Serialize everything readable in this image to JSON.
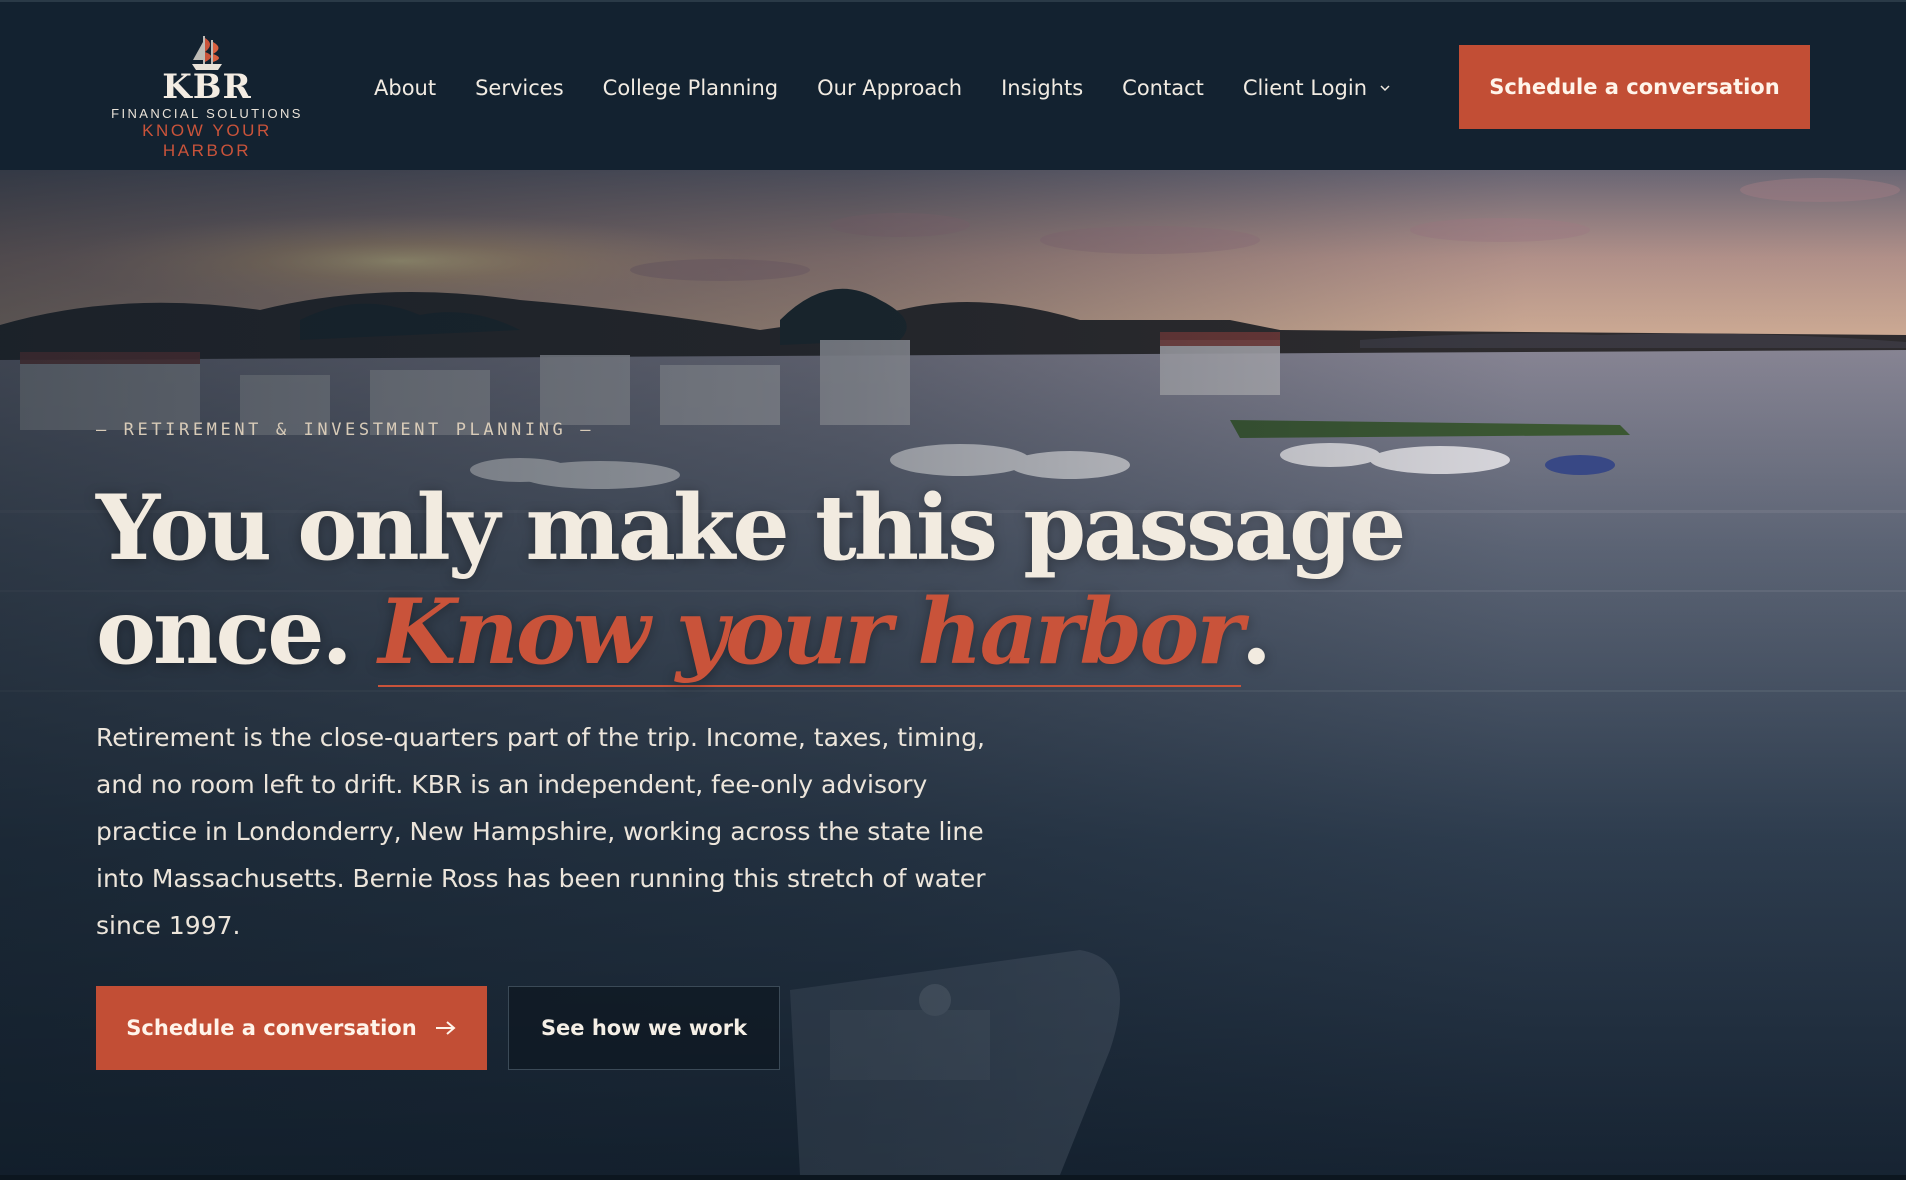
{
  "brand": {
    "wordmark": "KBR",
    "subtitle": "FINANCIAL SOLUTIONS",
    "tagline": "KNOW YOUR HARBOR",
    "accent_color": "#c24e35",
    "navy_color": "#132230"
  },
  "nav": {
    "items": [
      {
        "label": "About"
      },
      {
        "label": "Services"
      },
      {
        "label": "College Planning"
      },
      {
        "label": "Our Approach"
      },
      {
        "label": "Insights"
      },
      {
        "label": "Contact"
      },
      {
        "label": "Client Login",
        "icon": "chevron-down-icon"
      }
    ],
    "cta_label": "Schedule a conversation"
  },
  "hero": {
    "eyebrow": "— RETIREMENT & INVESTMENT PLANNING —",
    "headline_line1": "You only make this passage",
    "headline_line2_prefix": "once. ",
    "headline_accent": "Know your harbor",
    "headline_suffix": ".",
    "body": "Retirement is the close-quarters part of the trip. Income, taxes, timing, and no room left to drift. KBR is an independent, fee-only advisory practice in Londonderry, New Hampshire, working across the state line into Massachusetts. Bernie Ross has been running this stretch of water since 1997.",
    "primary_cta": "Schedule a conversation",
    "primary_cta_icon": "arrow-right-icon",
    "secondary_cta": "See how we work",
    "background": "harbor-at-dusk-photo"
  }
}
